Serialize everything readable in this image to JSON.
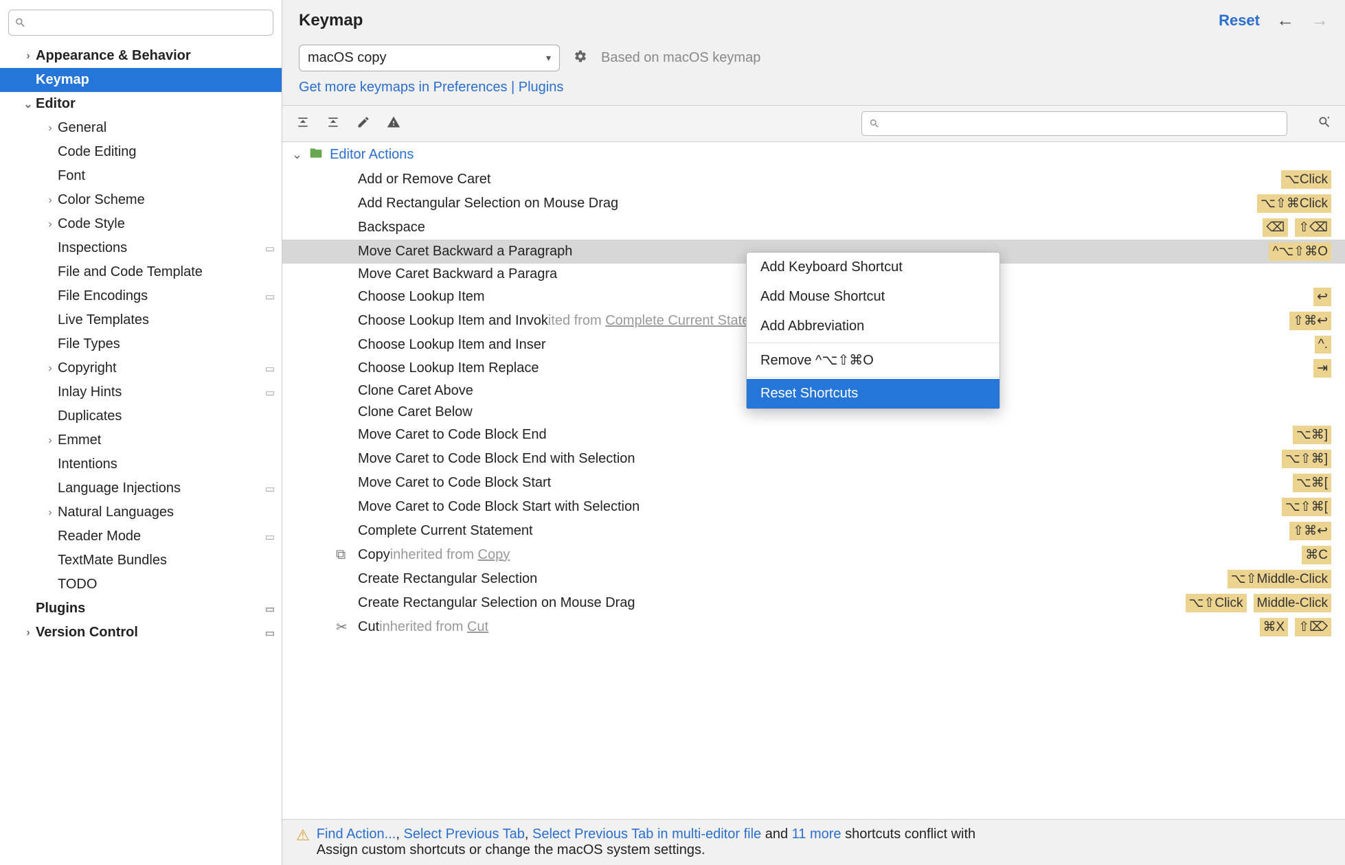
{
  "header": {
    "title": "Keymap",
    "reset": "Reset"
  },
  "sidebar": {
    "search_placeholder": "",
    "items": [
      {
        "label": "Appearance & Behavior",
        "bold": true,
        "chev": ">",
        "indent": 1
      },
      {
        "label": "Keymap",
        "bold": true,
        "chev": "",
        "indent": 1,
        "selected": true
      },
      {
        "label": "Editor",
        "bold": true,
        "chev": "v",
        "indent": 1
      },
      {
        "label": "General",
        "chev": ">",
        "indent": 2
      },
      {
        "label": "Code Editing",
        "chev": "",
        "indent": 2
      },
      {
        "label": "Font",
        "chev": "",
        "indent": 2
      },
      {
        "label": "Color Scheme",
        "chev": ">",
        "indent": 2
      },
      {
        "label": "Code Style",
        "chev": ">",
        "indent": 2
      },
      {
        "label": "Inspections",
        "chev": "",
        "indent": 2,
        "sq": true
      },
      {
        "label": "File and Code Template",
        "chev": "",
        "indent": 2
      },
      {
        "label": "File Encodings",
        "chev": "",
        "indent": 2,
        "sq": true
      },
      {
        "label": "Live Templates",
        "chev": "",
        "indent": 2
      },
      {
        "label": "File Types",
        "chev": "",
        "indent": 2
      },
      {
        "label": "Copyright",
        "chev": ">",
        "indent": 2,
        "sq": true
      },
      {
        "label": "Inlay Hints",
        "chev": "",
        "indent": 2,
        "sq": true
      },
      {
        "label": "Duplicates",
        "chev": "",
        "indent": 2
      },
      {
        "label": "Emmet",
        "chev": ">",
        "indent": 2
      },
      {
        "label": "Intentions",
        "chev": "",
        "indent": 2
      },
      {
        "label": "Language Injections",
        "chev": "",
        "indent": 2,
        "sq": true
      },
      {
        "label": "Natural Languages",
        "chev": ">",
        "indent": 2
      },
      {
        "label": "Reader Mode",
        "chev": "",
        "indent": 2,
        "sq": true
      },
      {
        "label": "TextMate Bundles",
        "chev": "",
        "indent": 2
      },
      {
        "label": "TODO",
        "chev": "",
        "indent": 2
      },
      {
        "label": "Plugins",
        "bold": true,
        "chev": "",
        "indent": 1,
        "sq": true
      },
      {
        "label": "Version Control",
        "bold": true,
        "chev": ">",
        "indent": 1,
        "sq": true
      }
    ]
  },
  "keymap_select": {
    "value": "macOS copy",
    "based": "Based on macOS keymap"
  },
  "links": {
    "more_keymaps": "Get more keymaps in Preferences | Plugins"
  },
  "category": {
    "name": "Editor Actions"
  },
  "actions": [
    {
      "label": "Add or Remove Caret",
      "sc": [
        "⌥Click"
      ]
    },
    {
      "label": "Add Rectangular Selection on Mouse Drag",
      "sc": [
        "⌥⇧⌘Click"
      ]
    },
    {
      "label": "Backspace",
      "sc": [
        "⌫",
        "⇧⌫"
      ]
    },
    {
      "label": "Move Caret Backward a Paragraph",
      "sc": [
        "^⌥⇧⌘O"
      ],
      "selected": true
    },
    {
      "label": "Move Caret Backward a Paragra"
    },
    {
      "label": "Choose Lookup Item",
      "sc": [
        "↩"
      ]
    },
    {
      "label": "Choose Lookup Item and Invok",
      "inherited_tail": "ited from ",
      "inherited_link": "Complete Current Statement",
      "sc": [
        "⇧⌘↩"
      ]
    },
    {
      "label": "Choose Lookup Item and Inser",
      "sc": [
        "^."
      ]
    },
    {
      "label": "Choose Lookup Item Replace",
      "sc": [
        "⇥"
      ]
    },
    {
      "label": "Clone Caret Above"
    },
    {
      "label": "Clone Caret Below"
    },
    {
      "label": "Move Caret to Code Block End",
      "sc": [
        "⌥⌘]"
      ]
    },
    {
      "label": "Move Caret to Code Block End with Selection",
      "sc": [
        "⌥⇧⌘]"
      ]
    },
    {
      "label": "Move Caret to Code Block Start",
      "sc": [
        "⌥⌘["
      ]
    },
    {
      "label": "Move Caret to Code Block Start with Selection",
      "sc": [
        "⌥⇧⌘["
      ]
    },
    {
      "label": "Complete Current Statement",
      "sc": [
        "⇧⌘↩"
      ]
    },
    {
      "label": "Copy ",
      "inherited": "inherited from ",
      "inherited_link": "Copy",
      "icon": "copy",
      "sc": [
        "⌘C"
      ]
    },
    {
      "label": "Create Rectangular Selection",
      "sc": [
        "⌥⇧Middle-Click"
      ]
    },
    {
      "label": "Create Rectangular Selection on Mouse Drag",
      "sc": [
        "⌥⇧Click",
        "Middle-Click"
      ]
    },
    {
      "label": "Cut ",
      "inherited": "inherited from ",
      "inherited_link": "Cut",
      "icon": "cut",
      "sc": [
        "⌘X",
        "⇧⌦"
      ]
    }
  ],
  "context_menu": {
    "items": [
      {
        "label": "Add Keyboard Shortcut"
      },
      {
        "label": "Add Mouse Shortcut"
      },
      {
        "label": "Add Abbreviation"
      },
      {
        "sep": true
      },
      {
        "label": "Remove ^⌥⇧⌘O"
      },
      {
        "sep": true
      },
      {
        "label": "Reset Shortcuts",
        "selected": true
      }
    ]
  },
  "footer": {
    "prefix_links": [
      "Find Action...",
      "Select Previous Tab",
      "Select Previous Tab in multi-editor file"
    ],
    "and": " and ",
    "more": "11 more",
    "tail": " shortcuts conflict with",
    "line2": "Assign custom shortcuts or change the macOS system settings."
  }
}
